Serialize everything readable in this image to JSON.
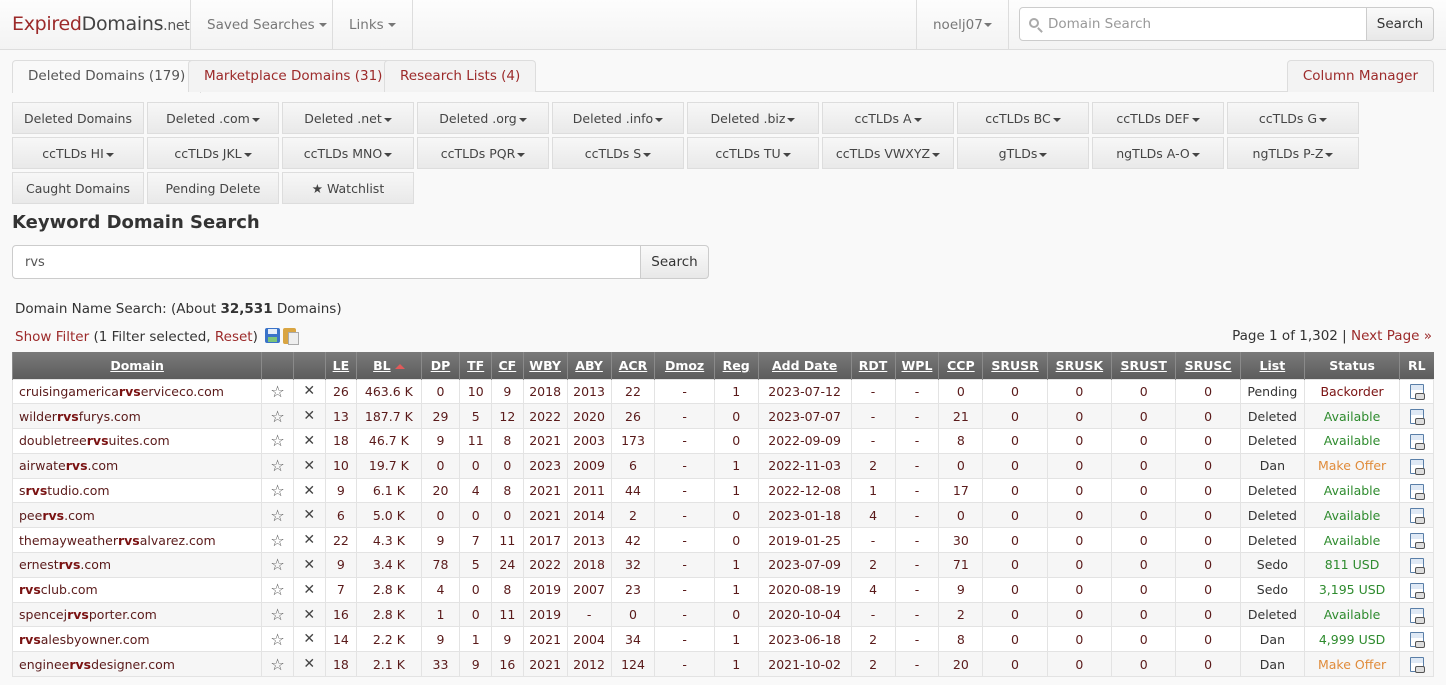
{
  "brand": {
    "part1": "Expired",
    "part2": "Domains",
    "part3": ".net"
  },
  "nav": {
    "saved_searches": "Saved Searches",
    "links": "Links",
    "user": "noelj07",
    "search_placeholder": "Domain Search",
    "search_button": "Search"
  },
  "tabs": [
    {
      "label": "Deleted Domains (179)",
      "active": true
    },
    {
      "label": "Marketplace Domains (31)",
      "active": false
    },
    {
      "label": "Research Lists (4)",
      "active": false
    }
  ],
  "column_manager": "Column Manager",
  "categories": [
    {
      "label": "Deleted Domains",
      "dropdown": false
    },
    {
      "label": "Deleted .com",
      "dropdown": true
    },
    {
      "label": "Deleted .net",
      "dropdown": true
    },
    {
      "label": "Deleted .org",
      "dropdown": true
    },
    {
      "label": "Deleted .info",
      "dropdown": true
    },
    {
      "label": "Deleted .biz",
      "dropdown": true
    },
    {
      "label": "ccTLDs A",
      "dropdown": true
    },
    {
      "label": "ccTLDs BC",
      "dropdown": true
    },
    {
      "label": "ccTLDs DEF",
      "dropdown": true
    },
    {
      "label": "ccTLDs G",
      "dropdown": true
    },
    {
      "label": "ccTLDs HI",
      "dropdown": true
    },
    {
      "label": "ccTLDs JKL",
      "dropdown": true
    },
    {
      "label": "ccTLDs MNO",
      "dropdown": true
    },
    {
      "label": "ccTLDs PQR",
      "dropdown": true
    },
    {
      "label": "ccTLDs S",
      "dropdown": true
    },
    {
      "label": "ccTLDs TU",
      "dropdown": true
    },
    {
      "label": "ccTLDs VWXYZ",
      "dropdown": true
    },
    {
      "label": "gTLDs",
      "dropdown": true
    },
    {
      "label": "ngTLDs A-O",
      "dropdown": true
    },
    {
      "label": "ngTLDs P-Z",
      "dropdown": true
    },
    {
      "label": "Caught Domains",
      "dropdown": false
    },
    {
      "label": "Pending Delete",
      "dropdown": false
    },
    {
      "label": "★ Watchlist",
      "dropdown": false
    }
  ],
  "keyword_search": {
    "title": "Keyword Domain Search",
    "value": "rvs",
    "button": "Search"
  },
  "results": {
    "prefix": "Domain Name Search: (About ",
    "count": "32,531",
    "suffix": " Domains)",
    "show_filter": "Show Filter",
    "filter_text": " (1 Filter selected, ",
    "reset": "Reset",
    "filter_close": ")",
    "page_text": "Page 1 of 1,302 | ",
    "next_page": "Next Page »"
  },
  "table": {
    "columns": [
      "Domain",
      "",
      "",
      "LE",
      "BL",
      "DP",
      "TF",
      "CF",
      "WBY",
      "ABY",
      "ACR",
      "Dmoz",
      "Reg",
      "Add Date",
      "RDT",
      "WPL",
      "CCP",
      "SRUSR",
      "SRUSK",
      "SRUST",
      "SRUSC",
      "List",
      "Status",
      "RL"
    ],
    "keyword": "rvs",
    "rows": [
      {
        "pre": "cruisingamerica",
        "kw": "rvs",
        "post": "erviceco.com",
        "LE": "26",
        "BL": "463.6 K",
        "DP": "0",
        "TF": "10",
        "CF": "9",
        "WBY": "2018",
        "ABY": "2013",
        "ACR": "22",
        "Dmoz": "-",
        "Reg": "1",
        "AddDate": "2023-07-12",
        "RDT": "-",
        "WPL": "-",
        "CCP": "0",
        "SRUSR": "0",
        "SRUSK": "0",
        "SRUST": "0",
        "SRUSC": "0",
        "List": "Pending",
        "Status": "Backorder",
        "status_type": "backorder"
      },
      {
        "pre": "wilder",
        "kw": "rvs",
        "post": "furys.com",
        "LE": "13",
        "BL": "187.7 K",
        "DP": "29",
        "TF": "5",
        "CF": "12",
        "WBY": "2022",
        "ABY": "2020",
        "ACR": "26",
        "Dmoz": "-",
        "Reg": "0",
        "AddDate": "2023-07-07",
        "RDT": "-",
        "WPL": "-",
        "CCP": "21",
        "SRUSR": "0",
        "SRUSK": "0",
        "SRUST": "0",
        "SRUSC": "0",
        "List": "Deleted",
        "Status": "Available",
        "status_type": "available"
      },
      {
        "pre": "doubletree",
        "kw": "rvs",
        "post": "uites.com",
        "LE": "18",
        "BL": "46.7 K",
        "DP": "9",
        "TF": "11",
        "CF": "8",
        "WBY": "2021",
        "ABY": "2003",
        "ACR": "173",
        "Dmoz": "-",
        "Reg": "0",
        "AddDate": "2022-09-09",
        "RDT": "-",
        "WPL": "-",
        "CCP": "8",
        "SRUSR": "0",
        "SRUSK": "0",
        "SRUST": "0",
        "SRUSC": "0",
        "List": "Deleted",
        "Status": "Available",
        "status_type": "available"
      },
      {
        "pre": "airwate",
        "kw": "rvs",
        "post": ".com",
        "LE": "10",
        "BL": "19.7 K",
        "DP": "0",
        "TF": "0",
        "CF": "0",
        "WBY": "2023",
        "ABY": "2009",
        "ACR": "6",
        "Dmoz": "-",
        "Reg": "1",
        "AddDate": "2022-11-03",
        "RDT": "2",
        "WPL": "-",
        "CCP": "0",
        "SRUSR": "0",
        "SRUSK": "0",
        "SRUST": "0",
        "SRUSC": "0",
        "List": "Dan",
        "Status": "Make Offer",
        "status_type": "offer"
      },
      {
        "pre": "s",
        "kw": "rvs",
        "post": "tudio.com",
        "LE": "9",
        "BL": "6.1 K",
        "DP": "20",
        "TF": "4",
        "CF": "8",
        "WBY": "2021",
        "ABY": "2011",
        "ACR": "44",
        "Dmoz": "-",
        "Reg": "1",
        "AddDate": "2022-12-08",
        "RDT": "1",
        "WPL": "-",
        "CCP": "17",
        "SRUSR": "0",
        "SRUSK": "0",
        "SRUST": "0",
        "SRUSC": "0",
        "List": "Deleted",
        "Status": "Available",
        "status_type": "available"
      },
      {
        "pre": "pee",
        "kw": "rvs",
        "post": ".com",
        "LE": "6",
        "BL": "5.0 K",
        "DP": "0",
        "TF": "0",
        "CF": "0",
        "WBY": "2021",
        "ABY": "2014",
        "ACR": "2",
        "Dmoz": "-",
        "Reg": "0",
        "AddDate": "2023-01-18",
        "RDT": "4",
        "WPL": "-",
        "CCP": "0",
        "SRUSR": "0",
        "SRUSK": "0",
        "SRUST": "0",
        "SRUSC": "0",
        "List": "Deleted",
        "Status": "Available",
        "status_type": "available"
      },
      {
        "pre": "themayweather",
        "kw": "rvs",
        "post": "alvarez.com",
        "LE": "22",
        "BL": "4.3 K",
        "DP": "9",
        "TF": "7",
        "CF": "11",
        "WBY": "2017",
        "ABY": "2013",
        "ACR": "42",
        "Dmoz": "-",
        "Reg": "0",
        "AddDate": "2019-01-25",
        "RDT": "-",
        "WPL": "-",
        "CCP": "30",
        "SRUSR": "0",
        "SRUSK": "0",
        "SRUST": "0",
        "SRUSC": "0",
        "List": "Deleted",
        "Status": "Available",
        "status_type": "available"
      },
      {
        "pre": "ernest",
        "kw": "rvs",
        "post": ".com",
        "LE": "9",
        "BL": "3.4 K",
        "DP": "78",
        "TF": "5",
        "CF": "24",
        "WBY": "2022",
        "ABY": "2018",
        "ACR": "32",
        "Dmoz": "-",
        "Reg": "1",
        "AddDate": "2023-07-09",
        "RDT": "2",
        "WPL": "-",
        "CCP": "71",
        "SRUSR": "0",
        "SRUSK": "0",
        "SRUST": "0",
        "SRUSC": "0",
        "List": "Sedo",
        "Status": "811 USD",
        "status_type": "usd"
      },
      {
        "pre": "",
        "kw": "rvs",
        "post": "club.com",
        "LE": "7",
        "BL": "2.8 K",
        "DP": "4",
        "TF": "0",
        "CF": "8",
        "WBY": "2019",
        "ABY": "2007",
        "ACR": "23",
        "Dmoz": "-",
        "Reg": "1",
        "AddDate": "2020-08-19",
        "RDT": "4",
        "WPL": "-",
        "CCP": "9",
        "SRUSR": "0",
        "SRUSK": "0",
        "SRUST": "0",
        "SRUSC": "0",
        "List": "Sedo",
        "Status": "3,195 USD",
        "status_type": "usd"
      },
      {
        "pre": "spencej",
        "kw": "rvs",
        "post": "porter.com",
        "LE": "16",
        "BL": "2.8 K",
        "DP": "1",
        "TF": "0",
        "CF": "11",
        "WBY": "2019",
        "ABY": "-",
        "ACR": "0",
        "Dmoz": "-",
        "Reg": "0",
        "AddDate": "2020-10-04",
        "RDT": "-",
        "WPL": "-",
        "CCP": "2",
        "SRUSR": "0",
        "SRUSK": "0",
        "SRUST": "0",
        "SRUSC": "0",
        "List": "Deleted",
        "Status": "Available",
        "status_type": "available"
      },
      {
        "pre": "",
        "kw": "rvs",
        "post": "alesbyowner.com",
        "LE": "14",
        "BL": "2.2 K",
        "DP": "9",
        "TF": "1",
        "CF": "9",
        "WBY": "2021",
        "ABY": "2004",
        "ACR": "34",
        "Dmoz": "-",
        "Reg": "1",
        "AddDate": "2023-06-18",
        "RDT": "2",
        "WPL": "-",
        "CCP": "8",
        "SRUSR": "0",
        "SRUSK": "0",
        "SRUST": "0",
        "SRUSC": "0",
        "List": "Dan",
        "Status": "4,999 USD",
        "status_type": "usd"
      },
      {
        "pre": "enginee",
        "kw": "rvs",
        "post": "designer.com",
        "LE": "18",
        "BL": "2.1 K",
        "DP": "33",
        "TF": "9",
        "CF": "16",
        "WBY": "2021",
        "ABY": "2012",
        "ACR": "124",
        "Dmoz": "-",
        "Reg": "1",
        "AddDate": "2021-10-02",
        "RDT": "2",
        "WPL": "-",
        "CCP": "20",
        "SRUSR": "0",
        "SRUSK": "0",
        "SRUST": "0",
        "SRUSC": "0",
        "List": "Dan",
        "Status": "Make Offer",
        "status_type": "offer"
      }
    ]
  },
  "icons": {
    "star": "☆",
    "remove": "✕",
    "sort_asc": "sort-up-icon"
  },
  "colors": {
    "brand_red": "#9c2a2a",
    "available": "#2e8b2e",
    "offer": "#e08b3a",
    "backorder": "#7a1212",
    "header_bg": "#666666"
  }
}
